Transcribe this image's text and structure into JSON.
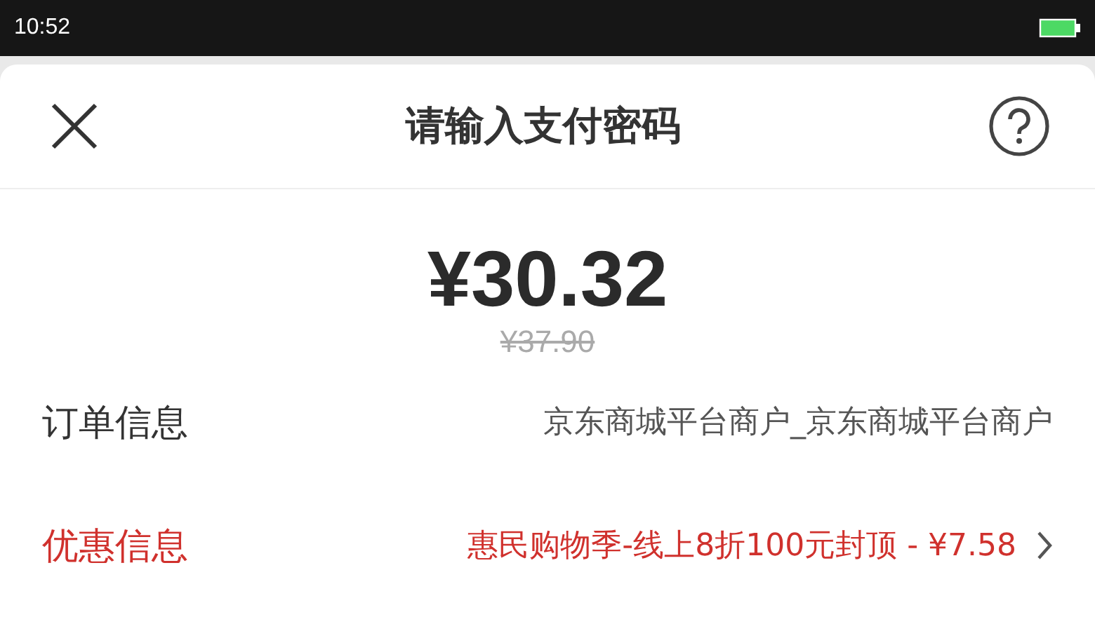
{
  "status_bar": {
    "time": "10:52"
  },
  "header": {
    "title": "请输入支付密码"
  },
  "amount": {
    "price": "¥30.32",
    "original_price": "¥37.90"
  },
  "rows": [
    {
      "kind": "plain",
      "label": "订单信息",
      "value": "京东商城平台商户_京东商城平台商户"
    },
    {
      "kind": "discount",
      "label": "优惠信息",
      "value": "惠民购物季-线上8折100元封顶 - ¥7.58"
    }
  ]
}
